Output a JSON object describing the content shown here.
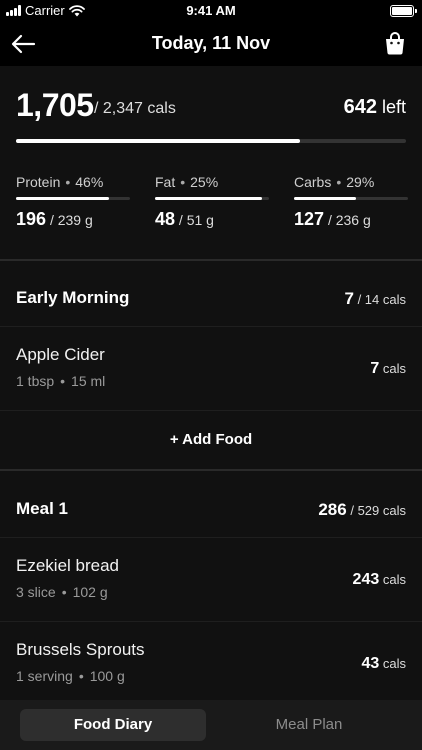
{
  "status": {
    "carrier": "Carrier",
    "time": "9:41 AM"
  },
  "nav": {
    "title": "Today, 11 Nov"
  },
  "summary": {
    "eaten": "1,705",
    "total": "/ 2,347 cals",
    "remaining": "642",
    "remaining_label": "left",
    "progress": 0.727,
    "macros": [
      {
        "name": "Protein",
        "percent": "46%",
        "value": "196",
        "goal": "/ 239 g",
        "progress": 0.82
      },
      {
        "name": "Fat",
        "percent": "25%",
        "value": "48",
        "goal": "/ 51 g",
        "progress": 0.94
      },
      {
        "name": "Carbs",
        "percent": "29%",
        "value": "127",
        "goal": "/ 236 g",
        "progress": 0.54
      }
    ]
  },
  "meals": [
    {
      "name": "Early Morning",
      "cals": "7",
      "goal": "/ 14 cals",
      "foods": [
        {
          "name": "Apple Cider",
          "amount": "1 tbsp",
          "weight": "15 ml",
          "cals": "7",
          "unit": "cals"
        }
      ],
      "add_label": "+ Add Food"
    },
    {
      "name": "Meal 1",
      "cals": "286",
      "goal": "/ 529 cals",
      "foods": [
        {
          "name": "Ezekiel bread",
          "amount": "3 slice",
          "weight": "102 g",
          "cals": "243",
          "unit": "cals"
        },
        {
          "name": "Brussels Sprouts",
          "amount": "1 serving",
          "weight": "100 g",
          "cals": "43",
          "unit": "cals"
        }
      ]
    }
  ],
  "tabs": [
    {
      "label": "Food Diary",
      "active": true
    },
    {
      "label": "Meal Plan",
      "active": false
    }
  ],
  "colors": {
    "background": "#111111",
    "bar_fill": "#ffffff",
    "bar_track": "#333333",
    "secondary_text": "#9a9a9a"
  }
}
